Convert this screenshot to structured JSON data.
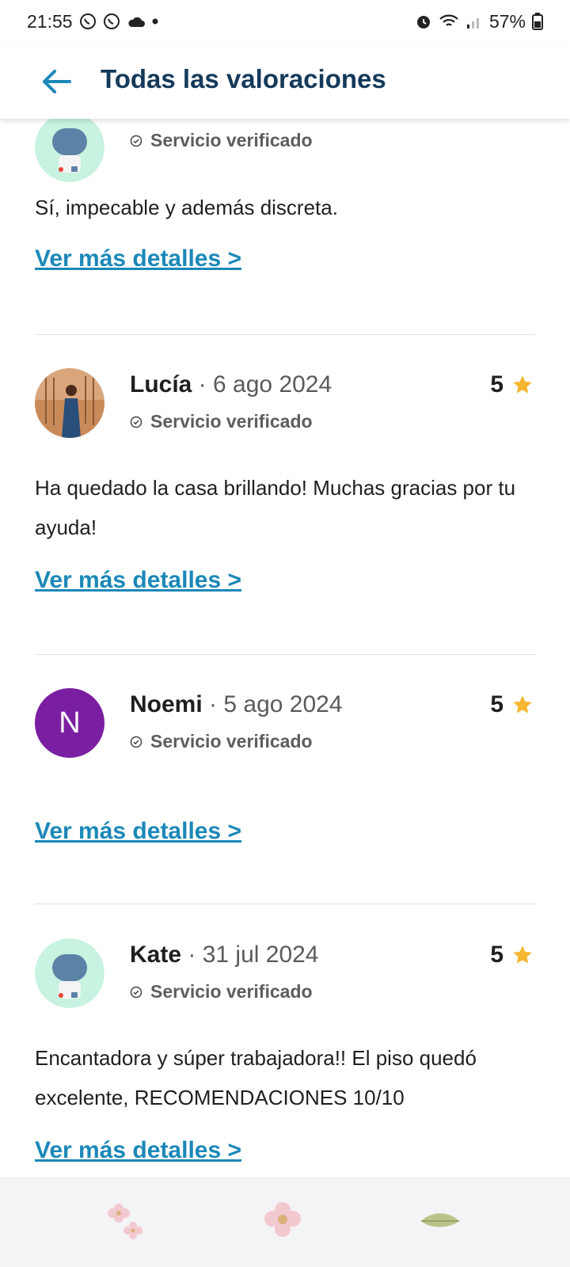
{
  "status": {
    "time": "21:55",
    "battery": "57%"
  },
  "header": {
    "title": "Todas las valoraciones"
  },
  "reviews": [
    {
      "verified": "Servicio verificado",
      "text": "Sí, impecable y además discreta.",
      "more": "Ver más detalles >"
    },
    {
      "name": "Lucía",
      "date": "6 ago 2024",
      "rating": "5",
      "verified": "Servicio verificado",
      "text": "Ha quedado la casa brillando! Muchas gracias por tu ayuda!",
      "more": "Ver más detalles >"
    },
    {
      "name": "Noemi",
      "initial": "N",
      "date": "5 ago 2024",
      "rating": "5",
      "verified": "Servicio verificado",
      "more": "Ver más detalles >"
    },
    {
      "name": "Kate",
      "date": "31 jul 2024",
      "rating": "5",
      "verified": "Servicio verificado",
      "text": "Encantadora y súper trabajadora!! El piso quedó excelente, RECOMENDACIONES 10/10",
      "more": "Ver más detalles >"
    }
  ],
  "colors": {
    "accent": "#1b88b8",
    "title": "#143a5a",
    "star": "#f7b731",
    "avatar_purple": "#7b1fa2"
  }
}
